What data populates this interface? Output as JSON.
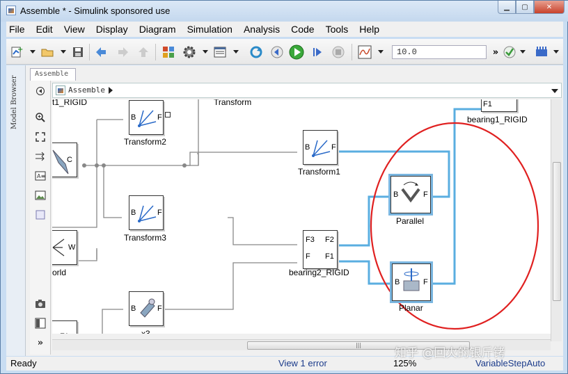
{
  "window": {
    "title": "Assemble * - Simulink sponsored use"
  },
  "menu": [
    "File",
    "Edit",
    "View",
    "Display",
    "Diagram",
    "Simulation",
    "Analysis",
    "Code",
    "Tools",
    "Help"
  ],
  "toolbar": {
    "stop_time": "10.0"
  },
  "model_browser": {
    "label": "Model Browser"
  },
  "tab": {
    "label": "Assemble"
  },
  "address": {
    "path": "Assemble"
  },
  "blocks": {
    "transform2": "Transform2",
    "transform1": "Transform1",
    "transform3": "Transform3",
    "parallel": "Parallel",
    "planar": "Planar",
    "bearing1": "bearing1_RIGID",
    "bearing2": "bearing2_RIGID",
    "x3": "x3",
    "world": "orld",
    "partial_top_left": "t1_RIGID",
    "partial_top_mid": "Transform"
  },
  "ports": {
    "B": "B",
    "F": "F",
    "F1": "F1",
    "F2": "F2",
    "F3": "F3",
    "W": "W",
    "C": "C"
  },
  "status": {
    "ready": "Ready",
    "errors": "View 1 error",
    "zoom": "125%",
    "solver": "VariableStepAuto"
  },
  "watermark": "知乎 @回火的银斤铐",
  "colors": {
    "selection": "#4aa0d8",
    "annotation_circle": "#e02020"
  }
}
